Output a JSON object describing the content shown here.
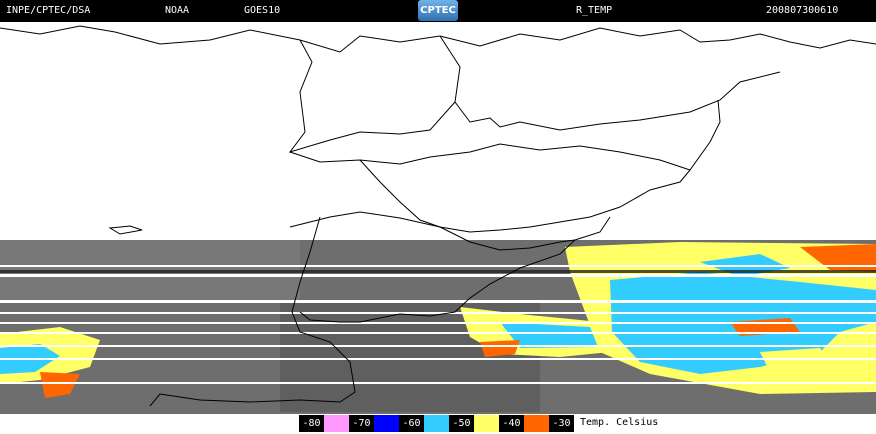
{
  "header": {
    "institution": "INPE/CPTEC/DSA",
    "agency": "NOAA",
    "satellite": "GOES10",
    "logo_text": "CPTEC",
    "product": "R_TEMP",
    "timestamp": "200807300610"
  },
  "legend": {
    "unit_label": "Temp. Celsius",
    "items": [
      {
        "value": "-80",
        "color": "#ff99ff"
      },
      {
        "value": "-70",
        "color": "#0000ff"
      },
      {
        "value": "-60",
        "color": "#33ccff"
      },
      {
        "value": "-50",
        "color": "#ffff66"
      },
      {
        "value": "-40",
        "color": "#ff6600"
      },
      {
        "value": "-30",
        "color": "#000000"
      }
    ]
  },
  "colors": {
    "cloud_gray": "#6e6e6e",
    "cold_blue": "#33ccff",
    "cold_yellow": "#ffff66",
    "warm_orange": "#ff6600",
    "border_line": "#000000"
  }
}
